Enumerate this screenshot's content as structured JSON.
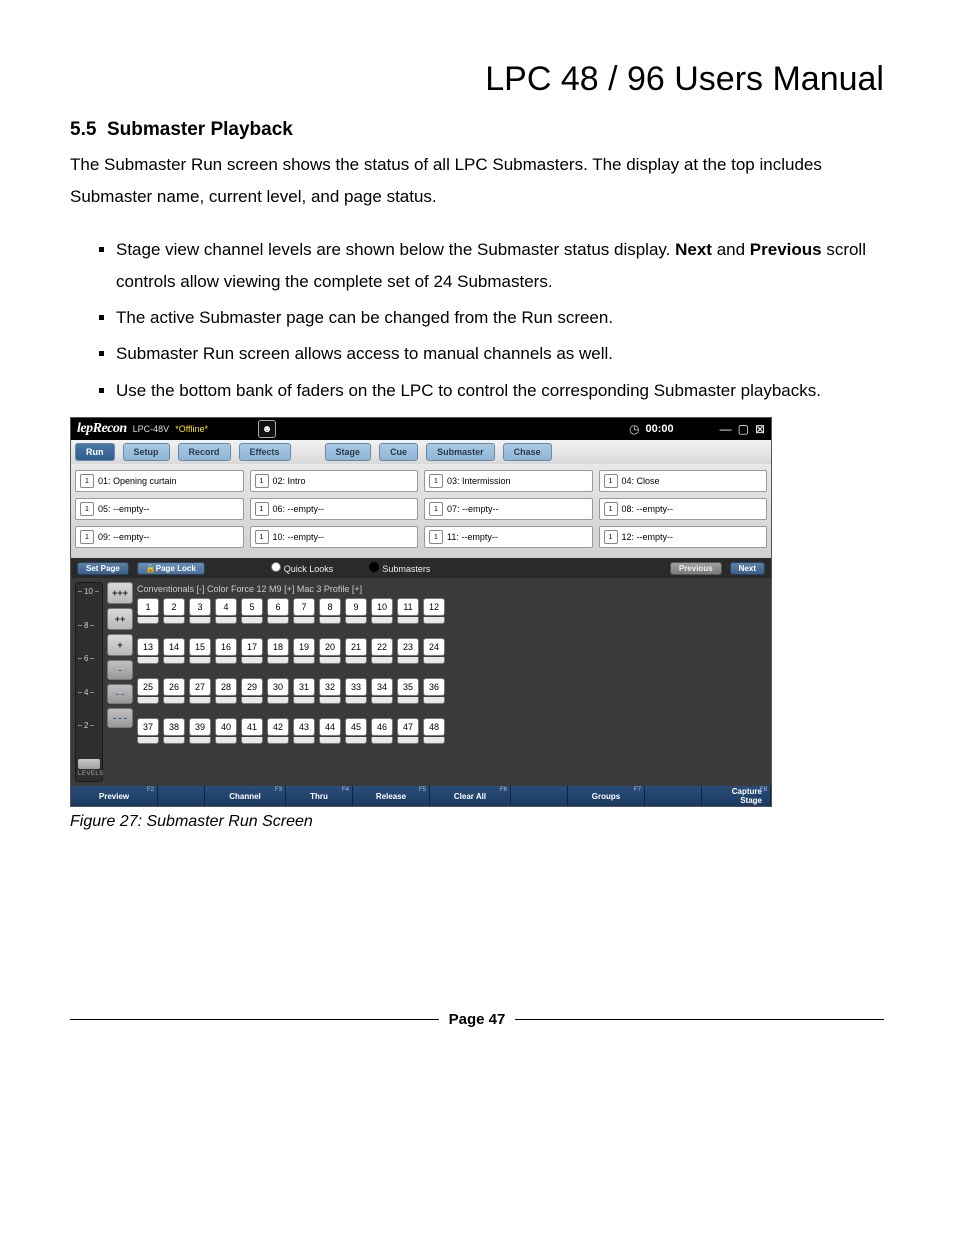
{
  "doc_title": "LPC 48 / 96 Users Manual",
  "section_number": "5.5",
  "section_title": "Submaster Playback",
  "intro": "The Submaster Run screen shows the status of all LPC Submasters.  The display at the top includes Submaster name, current level, and page status.",
  "bullets": [
    {
      "pre": "Stage view channel levels are shown below the Submaster status display. ",
      "b1": "Next",
      "mid": " and ",
      "b2": "Previous",
      "post": " scroll controls allow viewing the complete set of 24 Submasters."
    },
    {
      "pre": "The active Submaster page can be changed from the Run screen."
    },
    {
      "pre": "Submaster Run screen allows access to manual channels as well."
    },
    {
      "pre": "Use the bottom bank of faders on the LPC to control the corresponding Submaster playbacks."
    }
  ],
  "app": {
    "logo": "lepRecon",
    "model": "LPC-48V",
    "offline": "*Offline*",
    "clock": "00:00",
    "tabs": [
      "Run",
      "Setup",
      "Record",
      "Effects",
      "Stage",
      "Cue",
      "Submaster",
      "Chase"
    ],
    "active_tab": "Run",
    "subs": [
      [
        "01: Opening curtain",
        "02: Intro",
        "03: Intermission",
        "04: Close"
      ],
      [
        "05: --empty--",
        "06: --empty--",
        "07: --empty--",
        "08: --empty--"
      ],
      [
        "09: --empty--",
        "10: --empty--",
        "11: --empty--",
        "12: --empty--"
      ]
    ],
    "darkbar": {
      "set_page": "Set Page",
      "page_lock": "Page Lock",
      "quick_looks": "Quick Looks",
      "submasters": "Submasters",
      "previous": "Previous",
      "next": "Next"
    },
    "chan_header": "Conventionals [-] Color Force 12 M9 [+] Mac 3 Profile [+]",
    "pm_buttons": [
      "+++",
      "++",
      "+",
      "-",
      "- -",
      "- - -"
    ],
    "scale_ticks": [
      "10",
      "8",
      "6",
      "4",
      "2"
    ],
    "scale_label": "LEVELS",
    "channels": 48,
    "fkeys": [
      {
        "label": "Preview",
        "f": "F2"
      },
      {
        "label": "",
        "f": ""
      },
      {
        "label": "Channel",
        "f": "F3"
      },
      {
        "label": "Thru",
        "f": "F4"
      },
      {
        "label": "Release",
        "f": "F5"
      },
      {
        "label": "Clear All",
        "f": "F6"
      },
      {
        "label": "",
        "f": ""
      },
      {
        "label": "Groups",
        "f": "F7"
      },
      {
        "label": "",
        "f": ""
      },
      {
        "label": "Capture Stage",
        "f": "F8"
      }
    ]
  },
  "caption": "Figure 27: Submaster Run Screen",
  "page_number": "Page 47"
}
